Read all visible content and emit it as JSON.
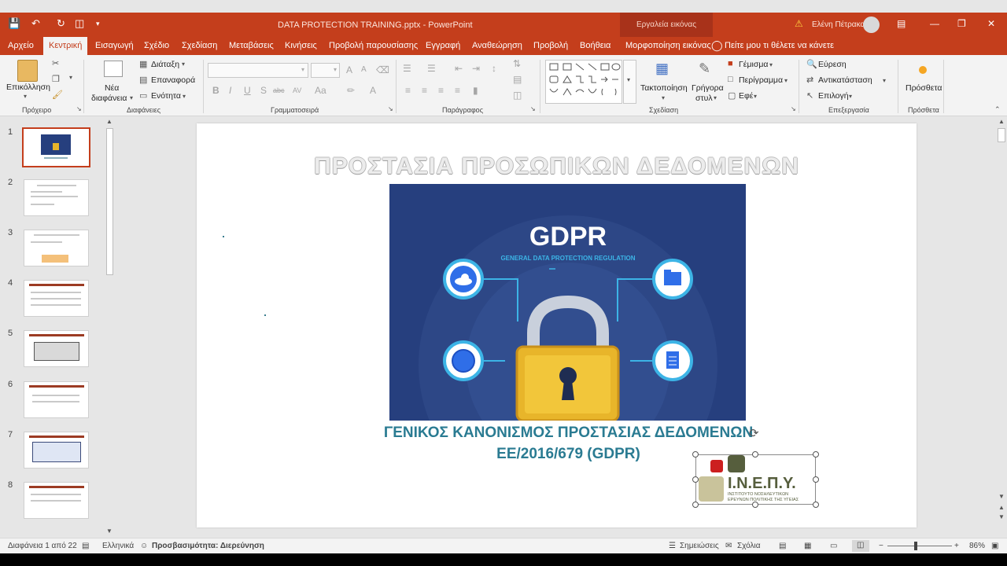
{
  "window": {
    "doc_title": "DATA PROTECTION TRAINING.pptx  -  PowerPoint",
    "context_tools": "Εργαλεία εικόνας",
    "user": "Ελένη Πέτρακα"
  },
  "tabs": [
    {
      "label": "Αρχείο"
    },
    {
      "label": "Κεντρική"
    },
    {
      "label": "Εισαγωγή"
    },
    {
      "label": "Σχέδιο"
    },
    {
      "label": "Σχεδίαση"
    },
    {
      "label": "Μεταβάσεις"
    },
    {
      "label": "Κινήσεις"
    },
    {
      "label": "Προβολή παρουσίασης"
    },
    {
      "label": "Εγγραφή"
    },
    {
      "label": "Αναθεώρηση"
    },
    {
      "label": "Προβολή"
    },
    {
      "label": "Βοήθεια"
    },
    {
      "label": "Μορφοποίηση εικόνας"
    }
  ],
  "tell_me": "Πείτε μου τι θέλετε να κάνετε",
  "ribbon": {
    "clipboard": {
      "paste": "Επικόλληση",
      "group": "Πρόχειρο"
    },
    "slides": {
      "new_slide_1": "Νέα",
      "new_slide_2": "διαφάνεια",
      "layout": "Διάταξη",
      "reset": "Επαναφορά",
      "section": "Ενότητα",
      "group": "Διαφάνειες"
    },
    "font": {
      "group": "Γραμματοσειρά"
    },
    "paragraph": {
      "group": "Παράγραφος"
    },
    "drawing": {
      "arrange": "Τακτοποίηση",
      "quick_styles_1": "Γρήγορα",
      "quick_styles_2": "στυλ",
      "fill": "Γέμισμα",
      "outline": "Περίγραμμα",
      "effects": "Εφέ",
      "group": "Σχεδίαση"
    },
    "editing": {
      "find": "Εύρεση",
      "replace": "Αντικατάσταση",
      "select": "Επιλογή",
      "group": "Επεξεργασία"
    },
    "addins": {
      "button": "Πρόσθετα",
      "group": "Πρόσθετα"
    }
  },
  "thumbnails": [
    "1",
    "2",
    "3",
    "4",
    "5",
    "6",
    "7",
    "8"
  ],
  "slide": {
    "title": "ΠΡΟΣΤΑΣΙΑ ΠΡΟΣΩΠΙΚΩΝ ΔΕΔΟΜΕΝΩΝ",
    "image": {
      "heading": "GDPR",
      "subheading": "GENERAL DATA PROTECTION REGULATION"
    },
    "subtitle_line1": "ΓΕΝΙΚΟΣ ΚΑΝΟΝΙΣΜΟΣ ΠΡΟΣΤΑΣΙΑΣ ΔΕΔΟΜΕΝΩΝ",
    "subtitle_line2": "ΕΕ/2016/679 (GDPR)",
    "logo": {
      "name": "Ι.Ν.Ε.Π.Υ.",
      "line1": "ΙΝΣΤΙΤΟΥΤΟ ΝΟΣΗΛΕΥΤΙΚΩΝ",
      "line2": "ΕΡΕΥΝΩΝ ΠΟΛΙΤΙΚΗΣ ΤΗΣ ΥΓΕΙΑΣ"
    }
  },
  "status": {
    "slide_count": "Διαφάνεια 1 από 22",
    "language": "Ελληνικά",
    "accessibility": "Προσβασιμότητα: Διερεύνηση",
    "notes": "Σημειώσεις",
    "comments": "Σχόλια",
    "zoom": "86%"
  },
  "colors": {
    "accent": "#c43e1c",
    "gdpr_bg": "#263f7e",
    "subtitle": "#2a7b92"
  }
}
